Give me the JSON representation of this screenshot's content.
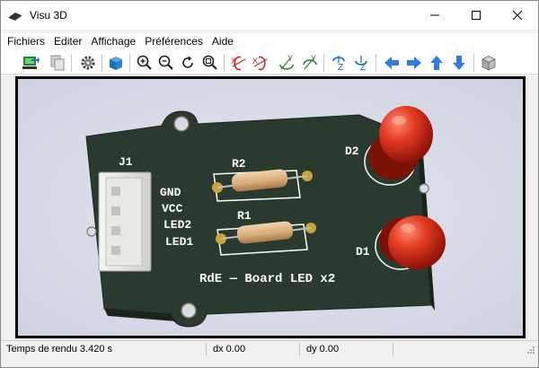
{
  "window": {
    "title": "Visu 3D",
    "controls": {
      "minimize": "—",
      "maximize": "☐",
      "close": "✕"
    }
  },
  "menu": [
    "Fichiers",
    "Editer",
    "Affichage",
    "Préférences",
    "Aide"
  ],
  "toolbar": {
    "buttons": [
      "export-icon",
      "copy-icon",
      "settings-gear-icon",
      "3d-box-icon",
      "zoom-in-icon",
      "zoom-out-icon",
      "redraw-icon",
      "zoom-fit-icon",
      "rotate-x-minus-icon",
      "rotate-x-plus-icon",
      "rotate-y-minus-icon",
      "rotate-y-plus-icon",
      "rotate-z-minus-icon",
      "rotate-z-plus-icon",
      "pan-left-icon",
      "pan-right-icon",
      "pan-up-icon",
      "pan-down-icon",
      "ortho-view-icon"
    ],
    "axis_labels": {
      "x": "X",
      "y": "Y",
      "z": "Z"
    }
  },
  "board": {
    "connector_ref": "J1",
    "pins": [
      "GND",
      "VCC",
      "LED2",
      "LED1"
    ],
    "resistors": [
      "R2",
      "R1"
    ],
    "leds": [
      "D2",
      "D1"
    ],
    "title_text": "RdE — Board LED x2",
    "colors": {
      "pcb": "#2c3a2d",
      "silk": "#ffffff",
      "led": "#d42a1a",
      "resistor": "#d9b58a",
      "pad": "#c8a23a"
    }
  },
  "status": {
    "render_time": "Temps de rendu 3.420 s",
    "dx": "dx 0.00",
    "dy": "dy 0.00"
  }
}
